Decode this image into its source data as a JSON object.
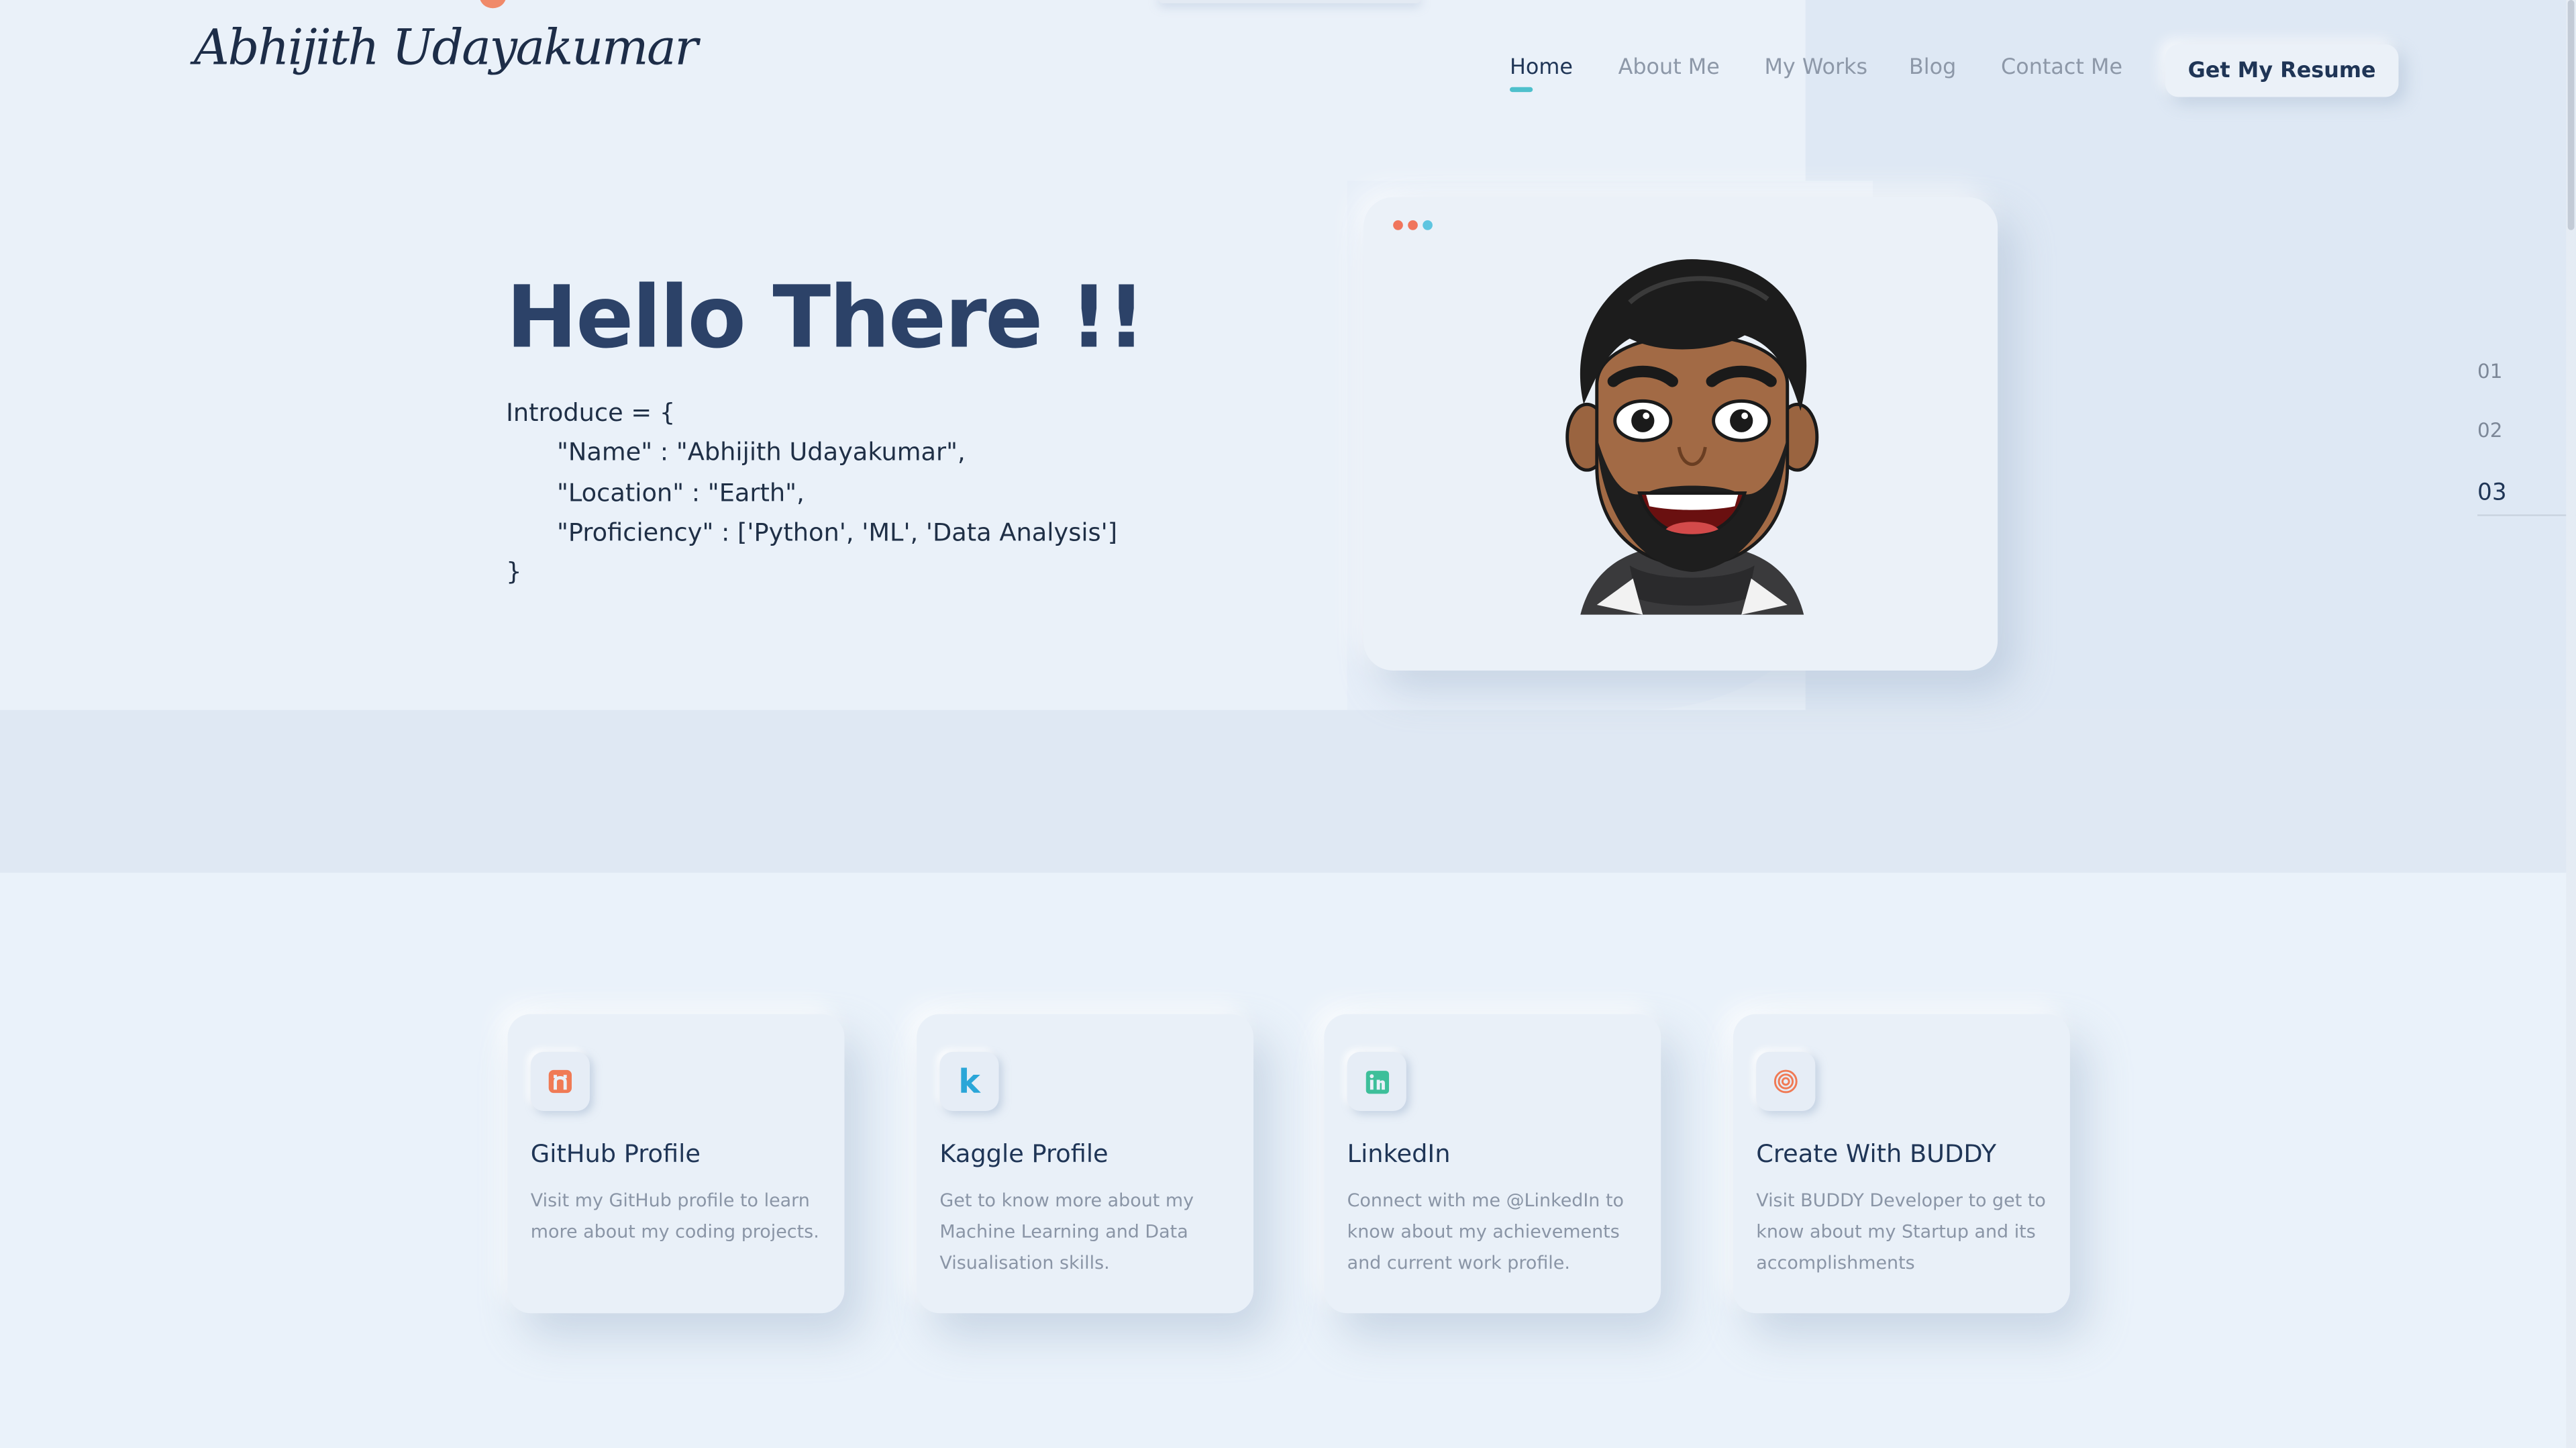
{
  "header": {
    "logo": "Abhijith Udayakumar",
    "nav": [
      {
        "label": "Home",
        "active": true
      },
      {
        "label": "About Me",
        "active": false
      },
      {
        "label": "My Works",
        "active": false
      },
      {
        "label": "Blog",
        "active": false
      },
      {
        "label": "Contact Me",
        "active": false
      }
    ],
    "resume_button": "Get My Resume"
  },
  "hero": {
    "title": "Hello There !!",
    "code": {
      "open": "Introduce = {",
      "name_line": "\"Name\" : \"Abhijith Udayakumar\",",
      "location_line": "\"Location\" : \"Earth\",",
      "proficiency_line": "\"Proficiency\" : ['Python', 'ML', 'Data Analysis']",
      "close": "}"
    }
  },
  "avatar_card": {
    "window_dots": [
      "#f0755c",
      "#f0755c",
      "#5ec5e0"
    ]
  },
  "pager": {
    "items": [
      "01",
      "02",
      "03"
    ],
    "active_index": 2
  },
  "cards": [
    {
      "icon": "github-icon",
      "icon_color": "#f07a55",
      "title": "GitHub Profile",
      "description": "Visit my GitHub profile to learn more about my coding projects."
    },
    {
      "icon": "kaggle-icon",
      "icon_color": "#2aa6d8",
      "title": "Kaggle Profile",
      "description": "Get to know more about my Machine Learning and Data Visualisation skills."
    },
    {
      "icon": "linkedin-icon",
      "icon_color": "#3dbf9a",
      "title": "LinkedIn",
      "description": "Connect with me @LinkedIn to know about my achievements and current work profile."
    },
    {
      "icon": "buddy-fingerprint-icon",
      "icon_color": "#f07a55",
      "title": "Create With BUDDY",
      "description": "Visit BUDDY Developer to get to know about my Startup and its accomplishments"
    }
  ],
  "colors": {
    "background": "#eaf1f9",
    "title": "#2c4268",
    "accent": "#4ec0cc"
  }
}
